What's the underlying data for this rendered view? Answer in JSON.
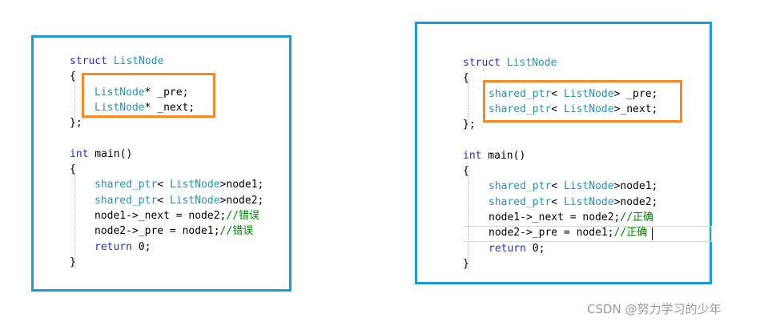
{
  "colors": {
    "panel_border": "#1e9ad6",
    "highlight_border": "#f08a2c",
    "keyword": "#2a2fd2",
    "type": "#2b91af",
    "comment": "#008000",
    "plain": "#000000"
  },
  "left_panel": {
    "lines": [
      [
        {
          "t": "struct",
          "c": "kw"
        },
        {
          "t": " ",
          "c": "pl"
        },
        {
          "t": "ListNode",
          "c": "ty"
        }
      ],
      [
        {
          "t": "{",
          "c": "pl"
        }
      ],
      [
        {
          "t": "ListNode",
          "c": "ty"
        },
        {
          "t": "* _pre;",
          "c": "pl"
        }
      ],
      [
        {
          "t": "ListNode",
          "c": "ty"
        },
        {
          "t": "* _next;",
          "c": "pl"
        }
      ],
      [
        {
          "t": "};",
          "c": "pl"
        }
      ],
      [],
      [
        {
          "t": "int",
          "c": "kw"
        },
        {
          "t": " main()",
          "c": "pl"
        }
      ],
      [
        {
          "t": "{",
          "c": "pl"
        }
      ],
      [
        {
          "t": "shared_ptr",
          "c": "ty"
        },
        {
          "t": "< ",
          "c": "pl"
        },
        {
          "t": "ListNode",
          "c": "ty"
        },
        {
          "t": ">node1;",
          "c": "pl"
        }
      ],
      [
        {
          "t": "shared_ptr",
          "c": "ty"
        },
        {
          "t": "< ",
          "c": "pl"
        },
        {
          "t": "ListNode",
          "c": "ty"
        },
        {
          "t": ">node2;",
          "c": "pl"
        }
      ],
      [
        {
          "t": "node1->_next = node2;",
          "c": "pl"
        },
        {
          "t": "//错误",
          "c": "cm"
        }
      ],
      [
        {
          "t": "node2->_pre = node1;",
          "c": "pl"
        },
        {
          "t": "//错误",
          "c": "cm"
        }
      ],
      [
        {
          "t": "return",
          "c": "kw"
        },
        {
          "t": " 0;",
          "c": "pl"
        }
      ],
      [
        {
          "t": "}",
          "c": "pl"
        }
      ]
    ]
  },
  "right_panel": {
    "lines": [
      [
        {
          "t": "struct",
          "c": "kw"
        },
        {
          "t": " ",
          "c": "pl"
        },
        {
          "t": "ListNode",
          "c": "ty"
        }
      ],
      [
        {
          "t": "{",
          "c": "pl"
        }
      ],
      [
        {
          "t": "shared_ptr",
          "c": "ty"
        },
        {
          "t": "< ",
          "c": "pl"
        },
        {
          "t": "ListNode",
          "c": "ty"
        },
        {
          "t": "> _pre;",
          "c": "pl"
        }
      ],
      [
        {
          "t": "shared_ptr",
          "c": "ty"
        },
        {
          "t": "< ",
          "c": "pl"
        },
        {
          "t": "ListNode",
          "c": "ty"
        },
        {
          "t": ">_next;",
          "c": "pl"
        }
      ],
      [
        {
          "t": "};",
          "c": "pl"
        }
      ],
      [],
      [
        {
          "t": "int",
          "c": "kw"
        },
        {
          "t": " main()",
          "c": "pl"
        }
      ],
      [
        {
          "t": "{",
          "c": "pl"
        }
      ],
      [
        {
          "t": "shared_ptr",
          "c": "ty"
        },
        {
          "t": "< ",
          "c": "pl"
        },
        {
          "t": "ListNode",
          "c": "ty"
        },
        {
          "t": ">node1;",
          "c": "pl"
        }
      ],
      [
        {
          "t": "shared_ptr",
          "c": "ty"
        },
        {
          "t": "< ",
          "c": "pl"
        },
        {
          "t": "ListNode",
          "c": "ty"
        },
        {
          "t": ">node2;",
          "c": "pl"
        }
      ],
      [
        {
          "t": "node1->_next = node2;",
          "c": "pl"
        },
        {
          "t": "//正确",
          "c": "cm"
        }
      ],
      [
        {
          "t": "node2->_pre = node1;",
          "c": "pl"
        },
        {
          "t": "//正确",
          "c": "cm"
        }
      ],
      [
        {
          "t": "return",
          "c": "kw"
        },
        {
          "t": " 0;",
          "c": "pl"
        }
      ],
      [
        {
          "t": "}",
          "c": "pl"
        }
      ]
    ]
  },
  "watermark": "CSDN @努力学习的少年"
}
